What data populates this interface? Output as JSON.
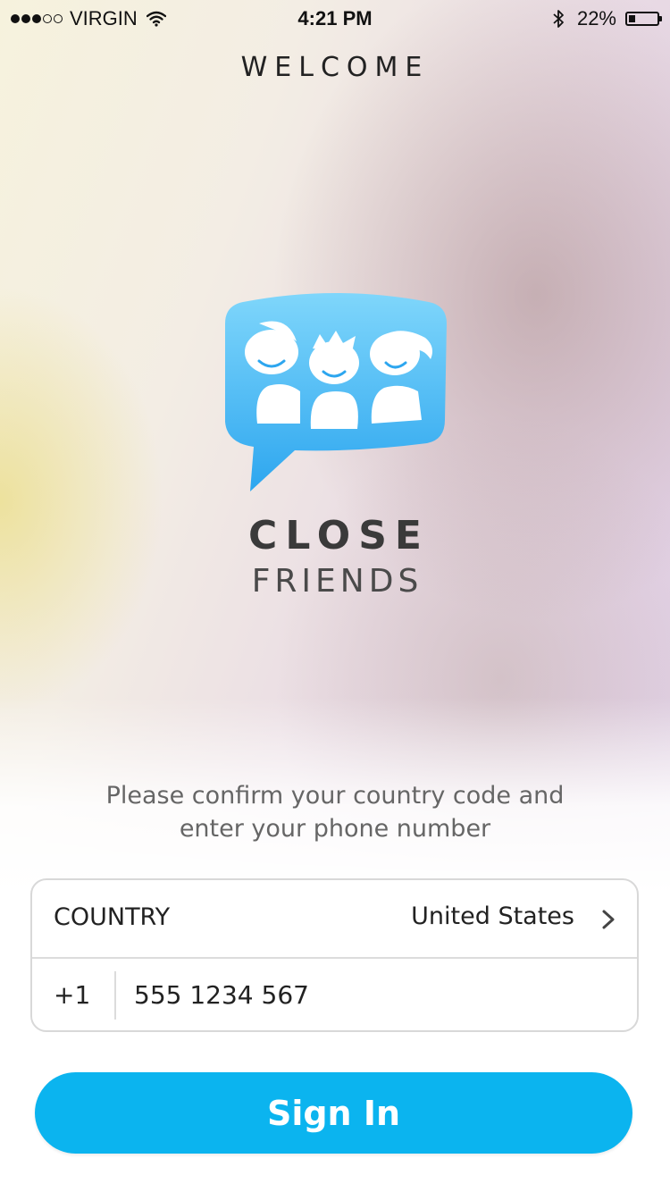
{
  "status_bar": {
    "carrier": "VIRGIN",
    "signal_filled": 3,
    "signal_total": 5,
    "time": "4:21 PM",
    "battery_percent_label": "22%",
    "battery_level": 0.22
  },
  "header": {
    "title": "WELCOME"
  },
  "brand": {
    "line1": "CLOSE",
    "line2": "FRIENDS",
    "logo_icon": "chat-bubble-friends-icon",
    "logo_color": "#2fa8ef"
  },
  "instruction": "Please confirm your country code and enter your phone number",
  "form": {
    "country_label": "COUNTRY",
    "country_value": "United States",
    "dial_code": "+1",
    "phone_value": "555 1234 567"
  },
  "signin": {
    "label": "Sign In",
    "color": "#0bb4ef"
  }
}
